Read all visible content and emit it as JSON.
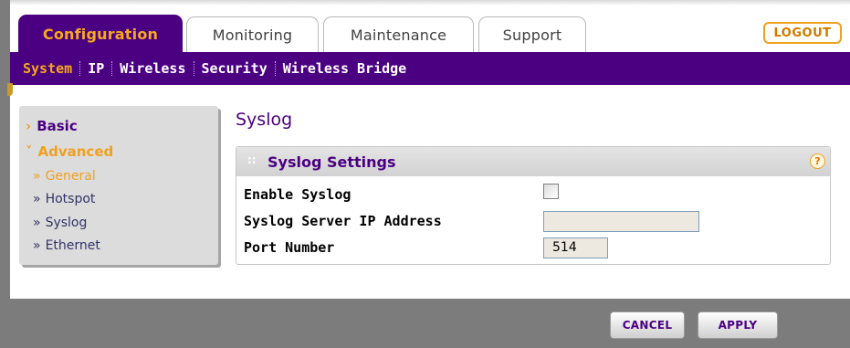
{
  "tabs": {
    "configuration": "Configuration",
    "monitoring": "Monitoring",
    "maintenance": "Maintenance",
    "support": "Support"
  },
  "logout_label": "LOGOUT",
  "subnav": {
    "system": "System",
    "ip": "IP",
    "wireless": "Wireless",
    "security": "Security",
    "wireless_bridge": "Wireless Bridge"
  },
  "leftmenu": {
    "basic": "Basic",
    "advanced": "Advanced",
    "general": "General",
    "hotspot": "Hotspot",
    "syslog": "Syslog",
    "ethernet": "Ethernet"
  },
  "page": {
    "title": "Syslog",
    "panel_title": "Syslog Settings"
  },
  "form": {
    "enable_syslog_label": "Enable Syslog",
    "enable_syslog_checked": false,
    "server_ip_label": "Syslog Server IP Address",
    "server_ip_value": "",
    "port_label": "Port Number",
    "port_value": "514"
  },
  "buttons": {
    "cancel": "CANCEL",
    "apply": "APPLY"
  },
  "colors": {
    "brand_purple": "#4b0082",
    "accent_orange": "#f7a81b"
  },
  "icons": {
    "help": "help-icon",
    "chevron": "chevron-right-icon",
    "expand": "chevron-down-icon"
  }
}
